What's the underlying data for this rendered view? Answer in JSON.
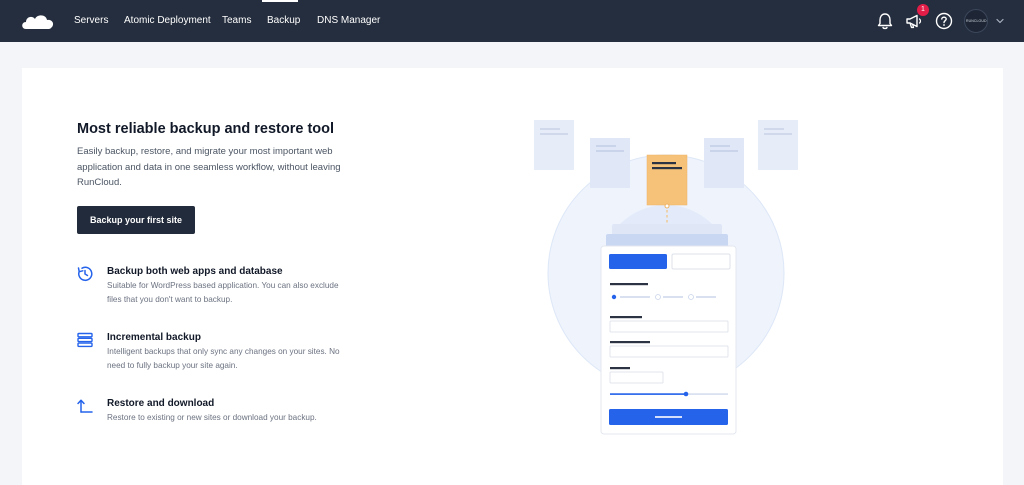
{
  "nav": {
    "brand_icon": "cloud-logo-icon",
    "items": [
      {
        "label": "Servers"
      },
      {
        "label": "Atomic Deployment"
      },
      {
        "label": "Teams"
      },
      {
        "label": "Backup"
      },
      {
        "label": "DNS Manager"
      }
    ],
    "active": "Backup",
    "icons": [
      "bell-icon",
      "megaphone-icon",
      "help-icon"
    ],
    "notification_count": "1",
    "avatar_text": "RUNCLOUD"
  },
  "hero": {
    "title": "Most reliable backup and restore tool",
    "description": "Easily backup, restore, and migrate your most important web application and data in one seamless workflow, without leaving RunCloud.",
    "cta_label": "Backup your first site"
  },
  "features": [
    {
      "icon": "clock-rotate-icon",
      "title": "Backup both web apps and database",
      "description": "Suitable for WordPress based application. You can also exclude files that you don't want to backup."
    },
    {
      "icon": "stack-layers-icon",
      "title": "Incremental backup",
      "description": "Intelligent backups that only sync any changes on your sites. No need to fully backup your site again."
    },
    {
      "icon": "arrow-up-restore-icon",
      "title": "Restore and download",
      "description": "Restore to existing or new sites or download your backup."
    }
  ],
  "colors": {
    "topbar": "#252e3e",
    "primary": "#2563eb",
    "button_dark": "#222b3b",
    "file_highlight": "#f6c27a",
    "badge": "#e11d48"
  }
}
